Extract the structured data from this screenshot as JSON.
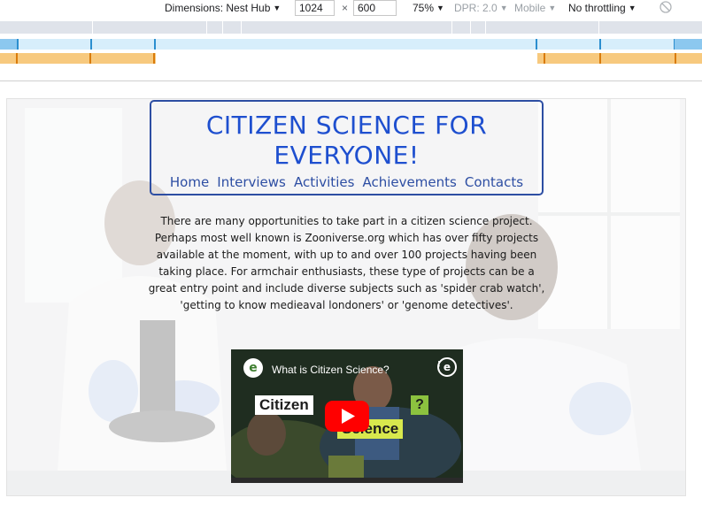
{
  "devtools": {
    "dimensions_label": "Dimensions: Nest Hub",
    "width_value": "1024",
    "times_sign": "×",
    "height_value": "600",
    "zoom": "75%",
    "dpr": "DPR: 2.0",
    "device_type": "Mobile",
    "throttling": "No throttling",
    "caret": "▼"
  },
  "site": {
    "title": "CITIZEN SCIENCE FOR EVERYONE!",
    "nav": [
      "Home",
      "Interviews",
      "Activities",
      "Achievements",
      "Contacts"
    ],
    "intro": "There are many opportunities to take part in a citizen science project. Perhaps most well known is Zooniverse.org which has over fifty projects available at the moment, with up to and over 100 projects having been taking place. For armchair enthusiasts, these type of projects can be a great entry point and include diverse subjects such as 'spider crab watch', 'getting to know medieaval londoners' or 'genome detectives'."
  },
  "video": {
    "channel_logo": "e",
    "title": "What is Citizen Science?",
    "menu_glyph": "⋮",
    "thumb_word_1": "Citizen",
    "thumb_word_2": "Science",
    "thumb_mark": "?",
    "icons": [
      "channel-logo-icon",
      "more-options-icon",
      "youtube-play-icon"
    ]
  },
  "colors": {
    "title_blue": "#1e4fcf",
    "nav_blue": "#2d4ea3",
    "youtube_red": "#ff0000",
    "thumb_green": "#d8e84d"
  }
}
